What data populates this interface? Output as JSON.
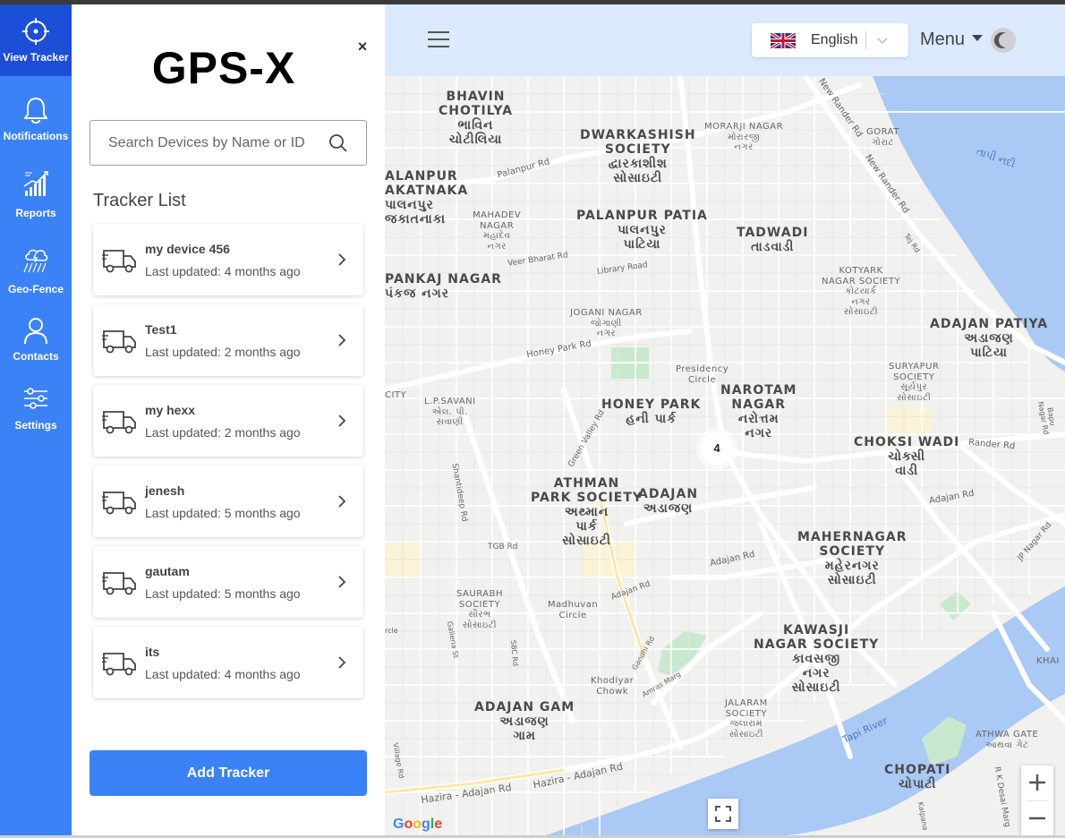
{
  "nav": {
    "items": [
      {
        "label": "View Tracker",
        "icon": "crosshair-icon",
        "active": true
      },
      {
        "label": "Notifications",
        "icon": "bell-icon"
      },
      {
        "label": "Reports",
        "icon": "growth-chart-icon"
      },
      {
        "label": "Geo-Fence",
        "icon": "geo-fence-icon"
      },
      {
        "label": "Contacts",
        "icon": "user-icon"
      },
      {
        "label": "Settings",
        "icon": "sliders-icon"
      }
    ]
  },
  "panel": {
    "close_label": "×",
    "logo": "GPS-X",
    "search_placeholder": "Search Devices by Name or ID",
    "list_title": "Tracker List",
    "trackers": [
      {
        "name": "my device 456",
        "updated": "Last updated: 4 months ago"
      },
      {
        "name": "Test1",
        "updated": "Last updated: 2 months ago"
      },
      {
        "name": "my hexx",
        "updated": "Last updated: 2 months ago"
      },
      {
        "name": "jenesh",
        "updated": "Last updated: 5 months ago"
      },
      {
        "name": "gautam",
        "updated": "Last updated: 5 months ago"
      },
      {
        "name": "its",
        "updated": "Last updated: 4 months ago"
      }
    ],
    "add_button": "Add Tracker"
  },
  "topbar": {
    "language": "English",
    "menu_label": "Menu"
  },
  "map": {
    "cluster_count": "4",
    "attribution": "Google",
    "colors": {
      "water": "#aac9f5",
      "road": "#ffffff",
      "park": "#c9e9cf",
      "land": "#f1f1ef"
    },
    "labels": {
      "bhavin": "BHAVIN\nCHOTILYA\nભાવિન\nચોટીલિયા",
      "dwarkashish": "DWARKASHISH\nSOCIETY\nદ્વારકાશીશ\nસોસાઇટી",
      "morarji": "MORARJI NAGAR\nમોરારજી\nનગર",
      "gorat": "GORAT\nગોરાટ",
      "tapi_river_guj": "તાપી નદી",
      "palanpur": "ALANPUR\nAKATNAKA\nપાલનપુર\nજકાતનાકા",
      "mahadev": "MAHADEV\nNAGAR\nમહાદેવ\nનગર",
      "palanpur_patia": "PALANPUR PATIA\nપાલનપુર\nપાટિયા",
      "tadwadi": "TADWADI\nતાડવાડી",
      "pankaj": "PANKAJ NAGAR\nપંકજ નગર",
      "kotyark": "KOTYARK\nNAGAR SOCIETY\nકોટયાર્ક\nનગર\nસોસાઇટી",
      "adajan_patiya": "ADAJAN PATIYA\nઅડાજણ\nપાટિયા",
      "jogani": "JOGANI NAGAR\nજોગાણી\nનગર",
      "presidency": "Presidency\nCircle",
      "suryapur": "SURYAPUR\nSOCIETY\nસૂર્યપુર\nસોસાઇટી",
      "city": "CITY",
      "lpsavani": "L.P.SAVANI\nએલ. પી.\nસવાણી",
      "honey_park": "HONEY PARK\nહની પાર્ક",
      "narotam": "NAROTAM\nNAGAR\nનરોત્તમ\nનગર",
      "choksi": "CHOKSI WADI\nચોક્સી\nવાડી",
      "athman": "ATHMAN\nPARK SOCIETY\nઅથ્માન\nપાર્ક\nસોસાઇટી",
      "adajan": "ADAJAN\nઅડાજણ",
      "mahernagar": "MAHERNAGAR\nSOCIETY\nમહેરનગર\nસોસાઇટી",
      "saurabh": "SAURABH\nSOCIETY\nસૌરભ\nસોસાઇટી",
      "madhuvan": "Madhuvan\nCircle",
      "kawasji": "KAWASJI\nNAGAR SOCIETY\nકાવસજી\nનગર\nસોસાઇટી",
      "khodiyar": "Khodiyar\nChowk",
      "jalaram": "JALARAM\nSOCIETY\nજલારામ\nસોસાઇટી",
      "adajan_gam": "ADAJAN GAM\nઅડાજણ\nગામ",
      "athwa": "ATHWA GATE\nઆથવા ગેટ",
      "chopati": "CHOPATI\nચોપાટી",
      "khai": "KHAI",
      "tapi_river": "Tapi River"
    },
    "roads": {
      "new_rander_1": "New Rander Rd",
      "new_rander_2": "New Rander Rd",
      "palanpur_rd": "Palanpur Rd",
      "veer_bharat": "Veer Bharat Rd",
      "library": "Library Road",
      "honey_park_rd": "Honey Park Rd",
      "green_valley": "Green Valley Rd",
      "shantideep": "Shantideep Rd",
      "tgb": "TGB Rd",
      "adajan_rd": "Adajan Rd",
      "adajan_rd2": "Adajan Rd",
      "adajan_rd3": "Adajan Rd",
      "rander_rd": "Rander Rd",
      "bapu_nagar": "Bapu Nagar Rd",
      "jp_nagar": "JP Nagar Rd",
      "hazira1": "Hazira - Adajan Rd",
      "hazira2": "Hazira - Adajan Rd",
      "gandhi": "Gandhi Rd",
      "amras": "Amras Marg",
      "sbc": "SBC Rd",
      "galleria": "Galleria St",
      "village": "Village Rd",
      "rk_desai": "R K Desai Marg",
      "tej": "Tej Rd",
      "cle": "rcle",
      "kalpana": "Kalpana"
    }
  }
}
